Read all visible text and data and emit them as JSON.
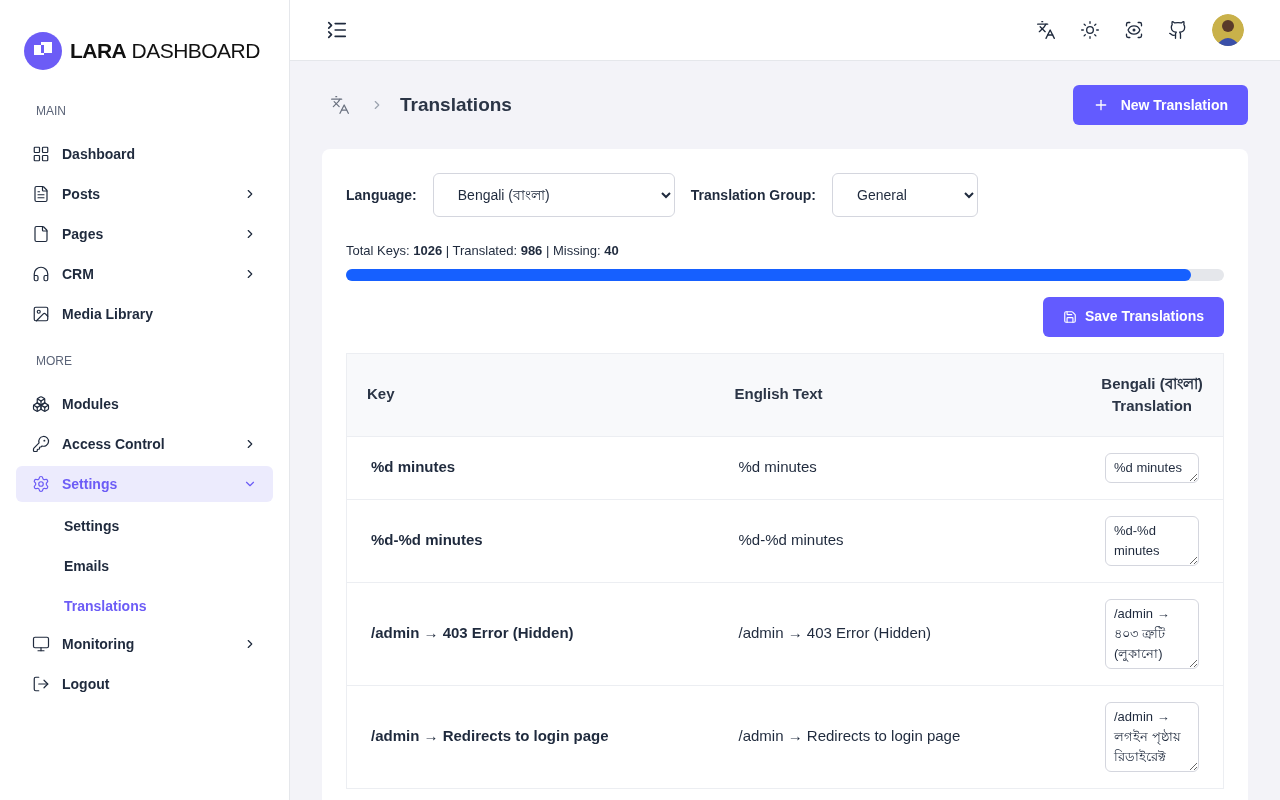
{
  "sidebar": {
    "logo": "**LARA** DASHBOARD",
    "sections": [
      {
        "title": "MAIN",
        "items": [
          {
            "label": "Dashboard",
            "submenu": false,
            "expanded": false,
            "selected": false
          },
          {
            "label": "Posts",
            "submenu": true,
            "expanded": false,
            "selected": false
          },
          {
            "label": "Pages",
            "submenu": true,
            "expanded": false,
            "selected": false
          },
          {
            "label": "CRM",
            "submenu": true,
            "expanded": false,
            "selected": false
          },
          {
            "label": "Media Library",
            "submenu": false,
            "expanded": false,
            "selected": false
          }
        ]
      },
      {
        "title": "MORE",
        "items": [
          {
            "label": "Modules",
            "submenu": false,
            "expanded": false,
            "selected": false
          },
          {
            "label": "Access Control",
            "submenu": true,
            "expanded": false,
            "selected": false
          },
          {
            "label": "Settings",
            "submenu": true,
            "expanded": true,
            "selected": true,
            "children": [
              {
                "label": "Settings",
                "selected": false
              },
              {
                "label": "Emails",
                "selected": false
              },
              {
                "label": "Translations",
                "selected": true
              }
            ]
          },
          {
            "label": "Monitoring",
            "submenu": true,
            "expanded": false,
            "selected": false
          },
          {
            "label": "Logout",
            "submenu": false,
            "expanded": false,
            "selected": false
          }
        ]
      }
    ]
  },
  "page": {
    "title": "Translations",
    "new_button": "New Translation"
  },
  "filters": {
    "language_label": "Language:",
    "language": "Bengali (বাংলা)",
    "group_label": "Translation Group:",
    "group": "General"
  },
  "stats": {
    "text": "Total Keys: **1026** | Translated: **986** | Missing: **40**",
    "level": 0.962
  },
  "save_button": "Save Translations",
  "table": {
    "columns": [
      "Key",
      "English Text",
      "Bengali (বাংলা) Translation"
    ],
    "rows": [
      {
        "key": "%d minutes",
        "english": "%d minutes",
        "translation": "%d minutes"
      },
      {
        "key": "%d-%d minutes",
        "english": "%d-%d minutes",
        "translation": "%d-%d minutes"
      },
      {
        "key": "/admin → 403 Error (Hidden)",
        "english": "/admin → 403 Error (Hidden)",
        "translation": "/admin → ৪০৩ ত্রুটি (লুকানো)"
      },
      {
        "key": "/admin → Redirects to login page",
        "english": "/admin → Redirects to login page",
        "translation": "/admin → লগইন পৃষ্ঠায় রিডাইরেক্ট"
      }
    ]
  }
}
